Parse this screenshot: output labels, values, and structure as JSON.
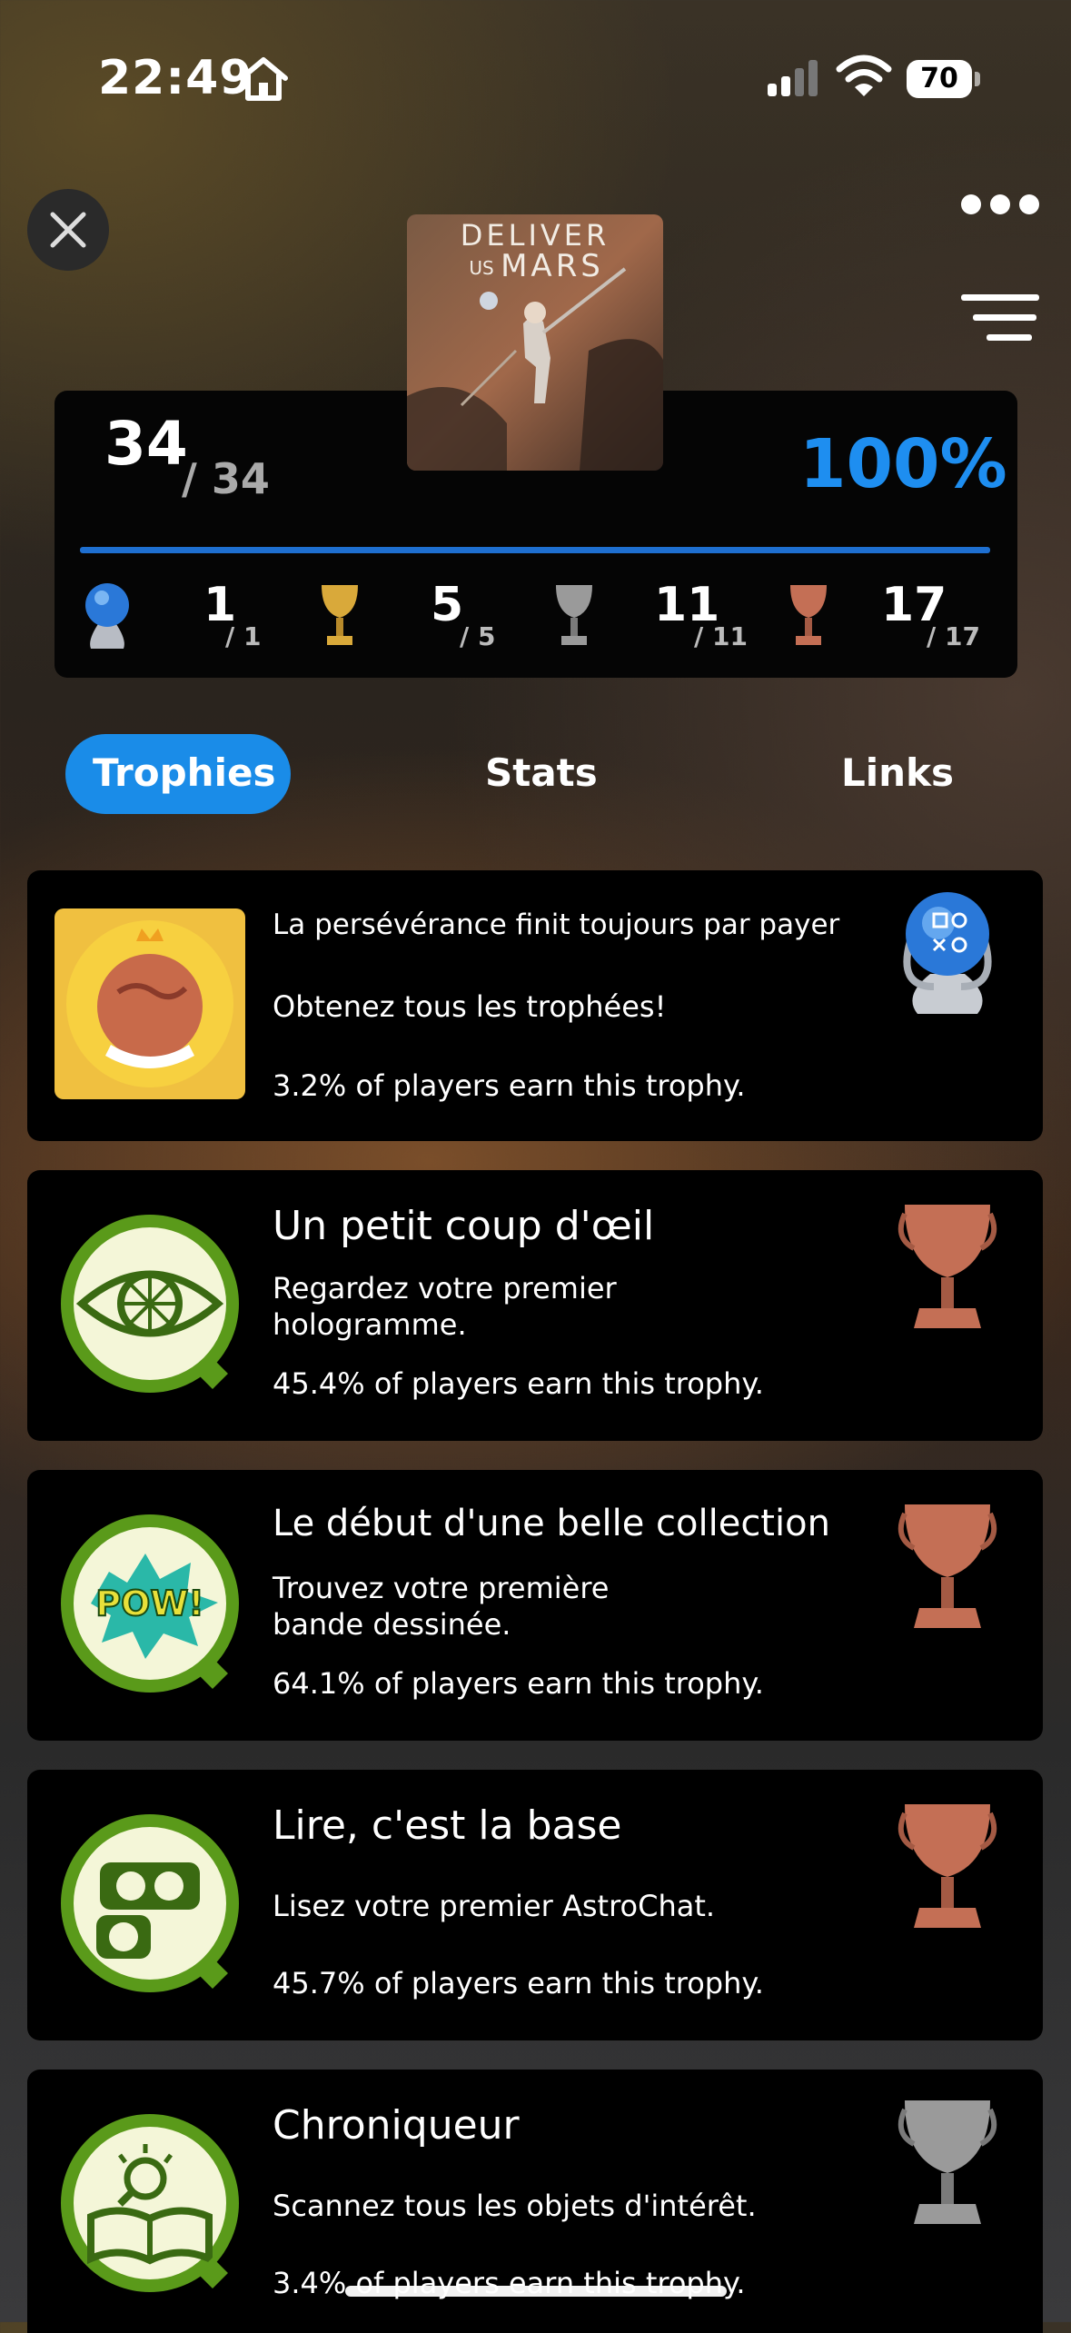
{
  "status_bar": {
    "time": "22:49",
    "battery": "70"
  },
  "game": {
    "cover_title_line1": "DELIVER",
    "cover_title_line2a": "US",
    "cover_title_line2b": "MARS"
  },
  "summary": {
    "earned": "34",
    "total": "/ 34",
    "percent": "100%",
    "progress_fraction": 1.0,
    "platinum": {
      "earned": "1",
      "total": "/ 1"
    },
    "gold": {
      "earned": "5",
      "total": "/ 5"
    },
    "silver": {
      "earned": "11",
      "total": "/ 11"
    },
    "bronze": {
      "earned": "17",
      "total": "/ 17"
    }
  },
  "tabs": [
    {
      "label": "Trophies",
      "active": true
    },
    {
      "label": "Stats",
      "active": false
    },
    {
      "label": "Links",
      "active": false
    }
  ],
  "trophies": [
    {
      "title": "La persévérance finit toujours par payer",
      "desc_line1": "Obtenez tous les trophées!",
      "desc_line2": "",
      "rate": "3.2% of players earn this trophy.",
      "grade": "platinum"
    },
    {
      "title": "Un petit coup d'œil",
      "desc_line1": "Regardez votre premier",
      "desc_line2": "hologramme.",
      "rate": "45.4% of players earn this trophy.",
      "grade": "bronze"
    },
    {
      "title": "Le début d'une belle collection",
      "desc_line1": "Trouvez votre première",
      "desc_line2": "bande dessinée.",
      "rate": "64.1% of players earn this trophy.",
      "grade": "bronze",
      "badge_text": "POW!"
    },
    {
      "title": "Lire, c'est la base",
      "desc_line1": "Lisez votre premier AstroChat.",
      "desc_line2": "",
      "rate": "45.7% of players earn this trophy.",
      "grade": "bronze"
    },
    {
      "title": "Chroniqueur",
      "desc_line1": "Scannez tous les objets d'intérêt.",
      "desc_line2": "",
      "rate": "3.4% of players earn this trophy.",
      "grade": "silver"
    }
  ],
  "colors": {
    "accent": "#1a8ce8",
    "percent": "#1e8ef0",
    "card_bg": "#000000",
    "gold": "#d9a93a",
    "silver": "#9a9a9a",
    "bronze": "#c46f55",
    "platinum": "#2f7fd8"
  }
}
